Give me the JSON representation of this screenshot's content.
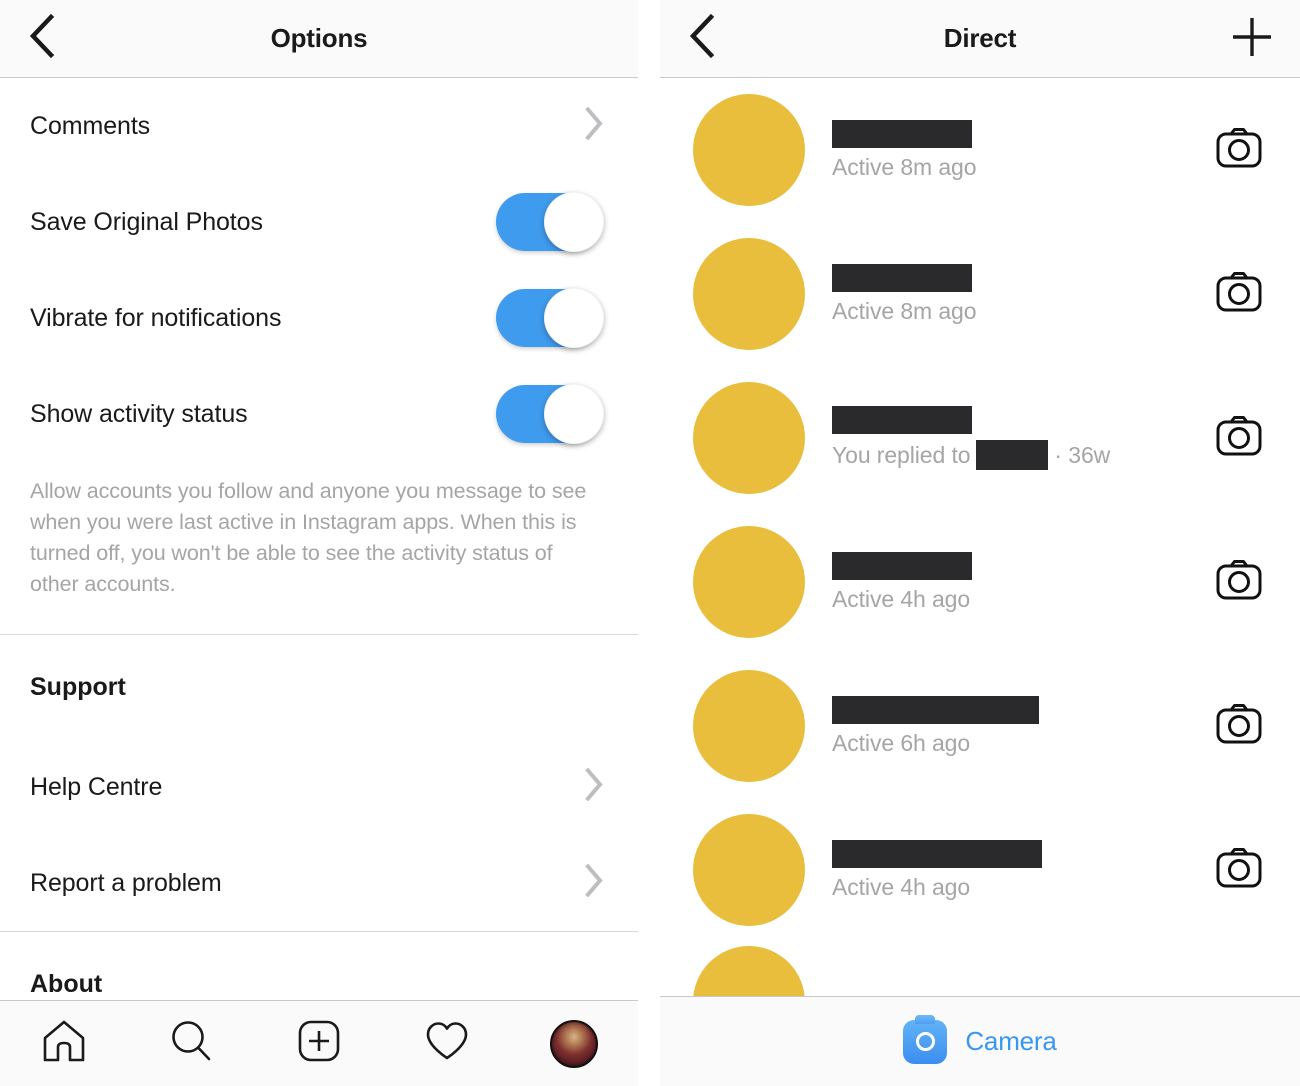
{
  "colors": {
    "toggle_on": "#3F9BEE",
    "avatar_yellow": "#E8BE3C",
    "redaction": "#2A2A2C",
    "link_blue": "#3897F0",
    "header_bg": "#FAFAFA",
    "muted_text": "#A5A5A8"
  },
  "options_panel": {
    "header": {
      "title": "Options",
      "back_icon": "chevron-left-icon"
    },
    "rows": [
      {
        "label": "Comments",
        "type": "link",
        "accessory": "chevron-right-icon"
      },
      {
        "label": "Save Original Photos",
        "type": "toggle",
        "value": "on"
      },
      {
        "label": "Vibrate for notifications",
        "type": "toggle",
        "value": "on"
      },
      {
        "label": "Show activity status",
        "type": "toggle",
        "value": "on"
      }
    ],
    "description": "Allow accounts you follow and anyone you message to see when you were last active in Instagram apps. When this is turned off, you won't be able to see the activity status of other accounts.",
    "support_heading": "Support",
    "support_rows": [
      {
        "label": "Help Centre",
        "accessory": "chevron-right-icon"
      },
      {
        "label": "Report a problem",
        "accessory": "chevron-right-icon"
      }
    ],
    "about_heading": "About",
    "tabbar": [
      {
        "icon": "home-icon",
        "name": "home"
      },
      {
        "icon": "search-icon",
        "name": "search"
      },
      {
        "icon": "add-post-icon",
        "name": "add-post"
      },
      {
        "icon": "heart-icon",
        "name": "activity"
      },
      {
        "icon": "profile-avatar",
        "name": "profile"
      }
    ]
  },
  "direct_panel": {
    "header": {
      "title": "Direct",
      "back_icon": "chevron-left-icon",
      "action_icon": "plus-icon"
    },
    "threads": [
      {
        "name_redacted": true,
        "name_width": 140,
        "status": "Active 8m ago",
        "action_icon": "camera-icon"
      },
      {
        "name_redacted": true,
        "name_width": 140,
        "status": "Active 8m ago",
        "action_icon": "camera-icon"
      },
      {
        "name_redacted": true,
        "name_width": 140,
        "status_prefix": "You replied to",
        "status_redacted_width": 72,
        "status_suffix": "· 36w",
        "action_icon": "camera-icon"
      },
      {
        "name_redacted": true,
        "name_width": 140,
        "status": "Active 4h ago",
        "action_icon": "camera-icon"
      },
      {
        "name_redacted": true,
        "name_width": 207,
        "status": "Active 6h ago",
        "action_icon": "camera-icon"
      },
      {
        "name_redacted": true,
        "name_width": 210,
        "status": "Active 4h ago",
        "action_icon": "camera-icon"
      }
    ],
    "camera_bar": {
      "label": "Camera",
      "icon": "camera-filled-icon"
    }
  }
}
